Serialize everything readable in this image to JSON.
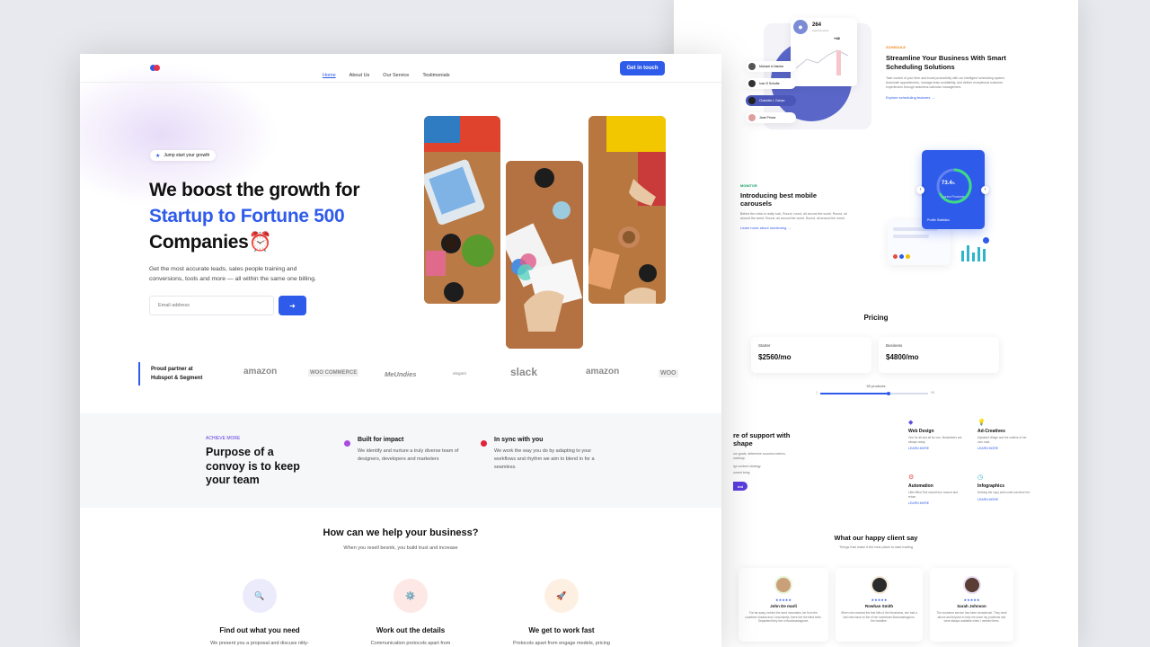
{
  "front": {
    "nav": {
      "items": [
        "Home",
        "About Us",
        "Our Service",
        "Testimonials"
      ],
      "cta": "Get in touch"
    },
    "hero": {
      "badge": "Jump start your growth",
      "title_line1": "We boost the growth for",
      "title_line2": "Startup to Fortune 500",
      "title_line3": "Companies",
      "emoji": "⏰",
      "desc": "Get the most accurate leads, sales people training and conversions, tools and more — all within the same one billing.",
      "email_placeholder": "Email address",
      "submit_icon": "arrow-right-icon"
    },
    "partners": {
      "label_line1": "Proud partner at",
      "label_line2": "Hubspot & Segment",
      "logos": [
        "amazon",
        "WOO COMMERCE",
        "MeUndies",
        "elegant",
        "slack",
        "amazon",
        "WOO"
      ]
    },
    "achieve": {
      "eyebrow": "ACHIEVE MORE",
      "title": "Purpose of a convoy is to keep your team",
      "items": [
        {
          "title": "Built for impact",
          "desc": "We identify and nurture a truly diverse team of designers, developers and marketers",
          "color": "#a64de0"
        },
        {
          "title": "In sync with you",
          "desc": "We work the way you do by adapting to your workflows and rhythm we aim to blend in for a seamless.",
          "color": "#e0243b"
        }
      ]
    },
    "help": {
      "title": "How can we help your business?",
      "subtitle": "When you resell besnik, you build trust and increase",
      "cards": [
        {
          "title": "Find out what you need",
          "desc": "We present you a proposal and discuss nitty-",
          "icon": "🔍",
          "bg": "#ecebfb"
        },
        {
          "title": "Work out the details",
          "desc": "Communication protocols apart from",
          "icon": "⚙️",
          "bg": "#fde8e6"
        },
        {
          "title": "We get to work fast",
          "desc": "Protocols apart from engage models, pricing",
          "icon": "🚀",
          "bg": "#fdf0e3"
        }
      ]
    }
  },
  "back": {
    "schedule": {
      "eyebrow": "SCHEDULE",
      "title": "Streamline Your Business With Smart Scheduling Solutions",
      "desc": "Take control of your time and boost productivity with our intelligent scheduling system. Automate appointments, manage team availability, and deliver exceptional customer experiences through seamless calendar management.",
      "link": "Explore scheduling features →",
      "stat": "264",
      "stat_label": "Appointments",
      "chart_tag": "+48",
      "people": [
        "Michael A Hambe",
        "Ivan S Schulte",
        "Charlotte L Gahan",
        "Jane Prince"
      ]
    },
    "mobile": {
      "eyebrow": "MONITOR",
      "title": "Introducing best mobile carousels",
      "desc": "Before the crisis is really luck, Round, round, all around the world. Round, all around the world. Round, all around the world. Round, all around the world.",
      "link": "Learn more about monitoring →",
      "gauge_value": "73.4",
      "gauge_unit": "%",
      "gauge_caption": "Lorem Products",
      "card_label": "Profile Statistics"
    },
    "pricing": {
      "title": "Pricing",
      "plans": [
        {
          "name": "Starter",
          "price": "$2560/mo"
        },
        {
          "name": "Business",
          "price": "$4800/mo"
        }
      ],
      "slider_label": "50 products",
      "slider_min": "1",
      "slider_max": "99"
    },
    "support": {
      "title_line1": "re of support with",
      "title_line2": "shape",
      "desc_lines": [
        "our goals, determine success metrics,",
        "oadmap.",
        "ign content strategy.",
        "ument bring"
      ],
      "button": "ind",
      "services": [
        {
          "title": "Web Design",
          "desc": "One for all and all for one, Musketeers are always ready.",
          "link": "LEARN MORE",
          "icon": "◆",
          "color": "#5b4de0"
        },
        {
          "title": "Ad-Creatives",
          "desc": "Alphabet Village and the subline of her own road.",
          "link": "LEARN MORE",
          "icon": "💡",
          "color": "#f2c200"
        },
        {
          "title": "Automation",
          "desc": "Little Blind Text should turn around and return.",
          "link": "LEARN MORE",
          "icon": "⚙",
          "color": "#e34b4b"
        },
        {
          "title": "Infographics",
          "desc": "Nothing the copy said could convince her.",
          "link": "LEARN MORE",
          "icon": "◷",
          "color": "#2fb5c9"
        }
      ]
    },
    "testimonials": {
      "title": "What our happy client say",
      "subtitle": "Things that make it the best place to start trading",
      "stars": "★★★★★",
      "people": [
        {
          "name": "John De marli",
          "desc": "Far far away, behind the word mountains, far from the countries Vokalia and Consonantia, there live the blind texts. Separated they live in Bookmarksgrove."
        },
        {
          "name": "Rowhan Smith",
          "desc": "When she reached the first hills of the Mountains, she had a last view back on the of her hometown Bookmarksgrove, the headline."
        },
        {
          "name": "Sarah Johnson",
          "desc": "The customer service has been exceptional. They went above and beyond to help me solve my problems and were always available when I needed them."
        }
      ]
    }
  }
}
